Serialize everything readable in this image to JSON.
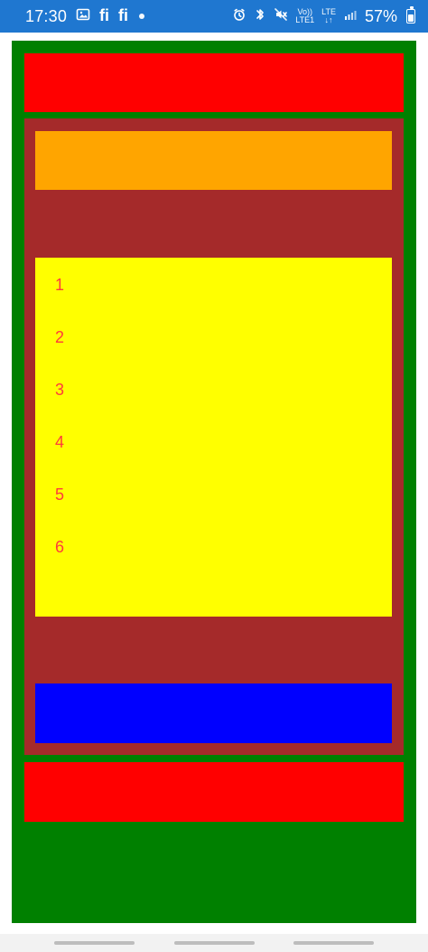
{
  "status_bar": {
    "time": "17:30",
    "battery_percent": "57%",
    "battery_level": 0.57,
    "net_label_top": "Vo))",
    "net_label_bottom": "LTE1",
    "net_type_top": "LTE",
    "net_type_bottom": "↓↑",
    "app_icons": [
      "image-icon",
      "fi-app-icon",
      "fi-app-icon"
    ],
    "right_icons": [
      "alarm-icon",
      "bluetooth-icon",
      "mute-icon",
      "signal-icon",
      "battery-icon"
    ],
    "colors": {
      "background": "#1f77d0",
      "foreground": "#ffffff"
    }
  },
  "screen": {
    "colors": {
      "outer_frame": "#008000",
      "top_bar": "#ff0000",
      "container": "#a52a2a",
      "header_block": "#ffa500",
      "list_background": "#ffff00",
      "list_text": "#ff3b3b",
      "footer_block": "#0000ff",
      "bottom_bar": "#ff0000",
      "nav_bar": "#f2f2f2",
      "nav_pill": "#bdbdbd"
    },
    "list": {
      "items": [
        "1",
        "2",
        "3",
        "4",
        "5",
        "6"
      ]
    }
  }
}
